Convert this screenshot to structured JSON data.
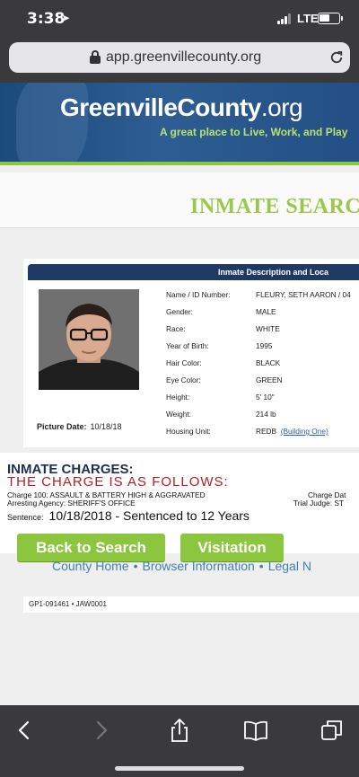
{
  "status_bar": {
    "time": "3:38",
    "network": "LTE"
  },
  "browser": {
    "url": "app.greenvillecounty.org"
  },
  "site": {
    "brand_main": "GreenvilleCounty",
    "brand_suffix": ".org",
    "tagline": "A great place to Live, Work, and Play",
    "page_title": "INMATE SEARC",
    "accent_color": "#8cc63f",
    "header_color": "#1e3a63"
  },
  "inmate": {
    "panel_header": "Inmate Description and Loca",
    "picture_date_label": "Picture Date:",
    "picture_date": "10/18/18",
    "fields": [
      {
        "label": "Name / ID Number:",
        "value": "FLEURY, SETH AARON / 04"
      },
      {
        "label": "Gender:",
        "value": "MALE"
      },
      {
        "label": "Race:",
        "value": "WHITE"
      },
      {
        "label": "Year of Birth:",
        "value": "1995"
      },
      {
        "label": "Hair Color:",
        "value": "BLACK"
      },
      {
        "label": "Eye Color:",
        "value": "GREEN"
      },
      {
        "label": "Height:",
        "value": "5' 10\""
      },
      {
        "label": "Weight:",
        "value": "214 lb"
      },
      {
        "label": "Housing Unit:",
        "value": "REDB",
        "link": "(Building One)"
      }
    ]
  },
  "charges": {
    "title": "INMATE CHARGES:",
    "subtitle": "THE CHARGE IS AS FOLLOWS:",
    "charge_line": "Charge 100: ASSAULT & BATTERY HIGH & AGGRAVATED",
    "charge_date_label": "Charge Dat",
    "agency_line": "Arresting Agency: SHERIFF'S OFFICE",
    "trial_judge_label": "Trial Judge: ST",
    "sentence_label": "Sentence:",
    "sentence_value": "10/18/2018 - Sentenced to 12 Years"
  },
  "buttons": {
    "back": "Back to Search",
    "visitation": "Visitation"
  },
  "footer": {
    "links": [
      "County Home",
      "Browser Information",
      "Legal N"
    ],
    "codes": "GP1-091461 • JAW0001"
  }
}
